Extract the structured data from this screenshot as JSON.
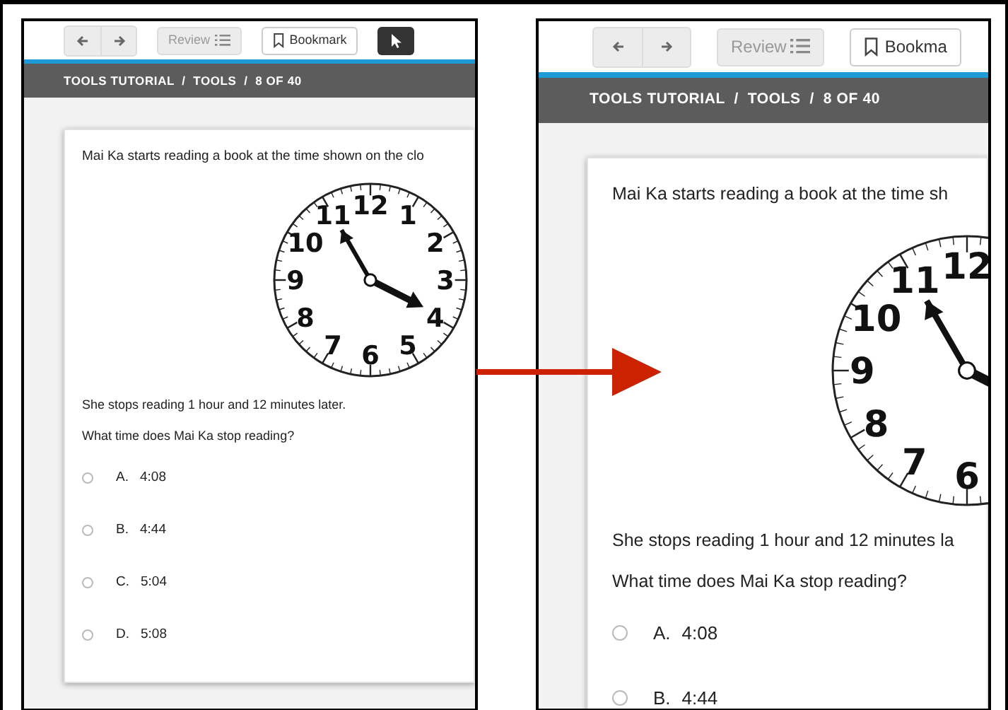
{
  "panels": [
    {
      "kind": "small",
      "toolbar": {
        "review": "Review",
        "bookmark": "Bookmark",
        "pointer_tool": true
      },
      "breadcrumb": "TOOLS TUTORIAL  /  TOOLS  /  8 OF 40",
      "question": "Mai Ka starts reading a book at the time shown on the clo",
      "clock": {
        "kind": "full",
        "numerals": [
          "12",
          "11",
          "1",
          "10",
          "2",
          "9",
          "3",
          "8",
          "4",
          "7",
          "5",
          "6"
        ]
      },
      "statements": [
        "She stops reading 1 hour and 12 minutes later.",
        "What time does Mai Ka stop reading?"
      ],
      "options": [
        {
          "letter": "A.",
          "text": "4:08",
          "selected": false
        },
        {
          "letter": "B.",
          "text": "4:44",
          "selected": false
        },
        {
          "letter": "C.",
          "text": "5:04",
          "selected": false
        },
        {
          "letter": "D.",
          "text": "5:08",
          "selected": false
        }
      ]
    },
    {
      "kind": "large",
      "toolbar": {
        "review": "Review",
        "bookmark": "Bookma",
        "pointer_tool": false
      },
      "breadcrumb": "TOOLS TUTORIAL  /  TOOLS  /  8 OF 40",
      "question": "Mai Ka starts reading a book at the time sh",
      "clock": {
        "kind": "left_half",
        "numerals": [
          "12",
          "11",
          "10",
          "9",
          "8",
          "7",
          "6"
        ]
      },
      "statements": [
        "She stops reading 1 hour and 12 minutes la",
        "What time does Mai Ka stop reading?"
      ],
      "options": [
        {
          "letter": "A.",
          "text": "4:08",
          "selected": false
        },
        {
          "letter": "B.",
          "text": "4:44",
          "selected": false
        }
      ]
    }
  ]
}
